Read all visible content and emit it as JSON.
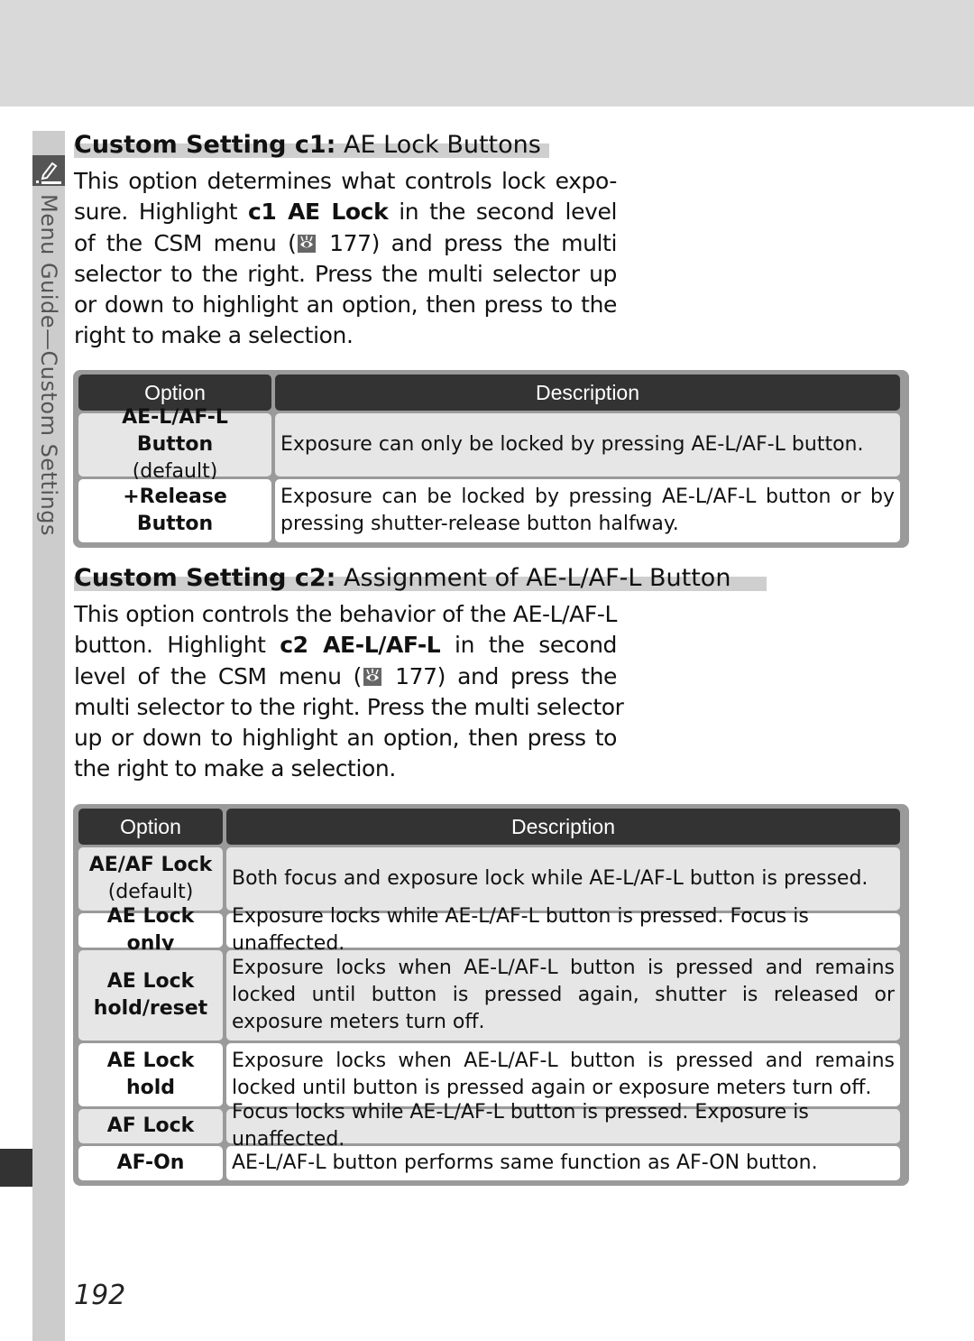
{
  "side_tab": {
    "label": "Menu Guide—Custom Settings",
    "icon": "pencil-icon"
  },
  "sections": [
    {
      "heading_bold": "Custom Setting c1:",
      "heading_rest": " AE Lock Buttons",
      "paragraph_lines": [
        "This option determines what controls lock expo-",
        "sure.  Highlight {b:c1 AE Lock} in the second level",
        "of the CSM menu ({ref} 177) and press the multi",
        "selector to the right.  Press the multi selector up",
        "or down to highlight an option, then press to the",
        "right to make a selection."
      ],
      "page_ref": "177",
      "table": {
        "headers": [
          "Option",
          "Description"
        ],
        "rows": [
          {
            "option": "AE-L/AF-L Button",
            "note": "(default)",
            "description": "Exposure can only be locked by pressing AE-L/AF-L button."
          },
          {
            "option": "+Release Button",
            "note": "",
            "description": "Exposure can be locked by pressing AE-L/AF-L button or by pressing shutter-release button halfway."
          }
        ]
      }
    },
    {
      "heading_bold": "Custom Setting c2:",
      "heading_rest": " Assignment of AE-L/AF-L Button",
      "paragraph_lines": [
        "This option controls the behavior of the AE-L/AF-L",
        "button.  Highlight {b:c2 AE-L/AF-L} in the second",
        "level of the CSM menu ({ref} 177) and press the",
        "multi selector to the right.  Press the multi selector",
        "up or down to highlight an option, then press to",
        "the right to make a selection."
      ],
      "page_ref": "177",
      "table": {
        "headers": [
          "Option",
          "Description"
        ],
        "rows": [
          {
            "option": "AE/AF Lock",
            "note": "(default)",
            "description": "Both focus and exposure lock while AE-L/AF-L button is pressed."
          },
          {
            "option": "AE Lock only",
            "note": "",
            "description": "Exposure locks while AE-L/AF-L button is pressed.  Focus is unaffected."
          },
          {
            "option": "AE Lock hold/reset",
            "note": "",
            "description": "Exposure locks when AE-L/AF-L button is pressed and remains locked until button is pressed again, shutter is released or exposure meters turn off."
          },
          {
            "option": "AE Lock hold",
            "note": "",
            "description": "Exposure locks when AE-L/AF-L button is pressed and remains locked until button is pressed again or exposure meters turn off."
          },
          {
            "option": "AF Lock",
            "note": "",
            "description": "Focus locks while AE-L/AF-L button is pressed.  Exposure is unaffected."
          },
          {
            "option": "AF-On",
            "note": "",
            "description": "AE-L/AF-L button performs same function as AF-ON button."
          }
        ]
      }
    }
  ],
  "page_number": "192",
  "colors": {
    "table_header_bg": "#333333",
    "table_frame": "#9a9a9a",
    "row_gray": "#e6e6e6",
    "side_bar": "#cccccc"
  }
}
